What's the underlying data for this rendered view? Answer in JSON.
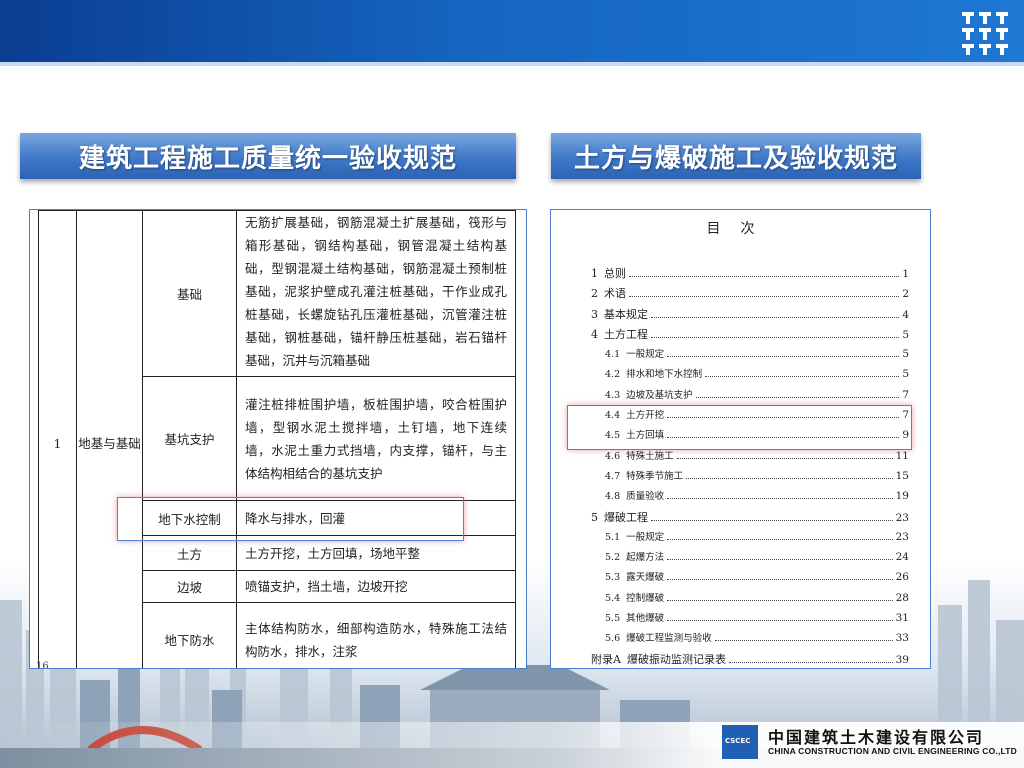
{
  "headings": {
    "left": "建筑工程施工质量统一验收规范",
    "right": "土方与爆破施工及验收规范"
  },
  "spec_table": {
    "row_no": "1",
    "category": "地基与基础",
    "rows": [
      {
        "sub": "基础",
        "desc": "无筋扩展基础，钢筋混凝土扩展基础，筏形与箱形基础，钢结构基础，钢管混凝土结构基础，型钢混凝土结构基础，钢筋混凝土预制桩基础，泥浆护壁成孔灌注桩基础，干作业成孔桩基础，长螺旋钻孔压灌桩基础，沉管灌注桩基础，钢桩基础，锚杆静压桩基础，岩石锚杆基础，沉井与沉箱基础"
      },
      {
        "sub": "基坑支护",
        "desc": "灌注桩排桩围护墙，板桩围护墙，咬合桩围护墙，型钢水泥土搅拌墙，土钉墙，地下连续墙，水泥土重力式挡墙，内支撑，锚杆，与主体结构相结合的基坑支护"
      },
      {
        "sub": "地下水控制",
        "desc": "降水与排水，回灌"
      },
      {
        "sub": "土方",
        "desc": "土方开挖，土方回填，场地平整"
      },
      {
        "sub": "边坡",
        "desc": "喷锚支护，挡土墙，边坡开挖"
      },
      {
        "sub": "地下防水",
        "desc": "主体结构防水，细部构造防水，特殊施工法结构防水，排水，注浆"
      }
    ],
    "page_mark": "16"
  },
  "toc": {
    "title": "目次",
    "items": [
      {
        "num": "1",
        "label": "总则",
        "page": "1",
        "level": 1
      },
      {
        "num": "2",
        "label": "术语",
        "page": "2",
        "level": 1
      },
      {
        "num": "3",
        "label": "基本规定",
        "page": "4",
        "level": 1
      },
      {
        "num": "4",
        "label": "土方工程",
        "page": "5",
        "level": 1
      },
      {
        "num": "4.1",
        "label": "一般规定",
        "page": "5",
        "level": 2
      },
      {
        "num": "4.2",
        "label": "排水和地下水控制",
        "page": "5",
        "level": 2
      },
      {
        "num": "4.3",
        "label": "边坡及基坑支护",
        "page": "7",
        "level": 2
      },
      {
        "num": "4.4",
        "label": "土方开挖",
        "page": "7",
        "level": 2
      },
      {
        "num": "4.5",
        "label": "土方回填",
        "page": "9",
        "level": 2
      },
      {
        "num": "4.6",
        "label": "特殊土施工",
        "page": "11",
        "level": 2
      },
      {
        "num": "4.7",
        "label": "特殊季节施工",
        "page": "15",
        "level": 2
      },
      {
        "num": "4.8",
        "label": "质量验收",
        "page": "19",
        "level": 2
      },
      {
        "num": "5",
        "label": "爆破工程",
        "page": "23",
        "level": 1
      },
      {
        "num": "5.1",
        "label": "一般规定",
        "page": "23",
        "level": 2
      },
      {
        "num": "5.2",
        "label": "起爆方法",
        "page": "24",
        "level": 2
      },
      {
        "num": "5.3",
        "label": "露天爆破",
        "page": "26",
        "level": 2
      },
      {
        "num": "5.4",
        "label": "控制爆破",
        "page": "28",
        "level": 2
      },
      {
        "num": "5.5",
        "label": "其他爆破",
        "page": "31",
        "level": 2
      },
      {
        "num": "5.6",
        "label": "爆破工程监测与验收",
        "page": "33",
        "level": 2
      },
      {
        "num": "附录A",
        "label": "爆破振动监测记录表",
        "page": "39",
        "level": 1
      }
    ]
  },
  "footer": {
    "company_cn": "中国建筑土木建设有限公司",
    "company_en": "CHINA CONSTRUCTION AND CIVIL ENGINEERING CO.,LTD",
    "logo_text": "CSCEC"
  },
  "colors": {
    "banner": "#1565c0",
    "heading": "#3f78c8",
    "panel_border": "#4a7fd0",
    "highlight": "#4a86d8"
  }
}
